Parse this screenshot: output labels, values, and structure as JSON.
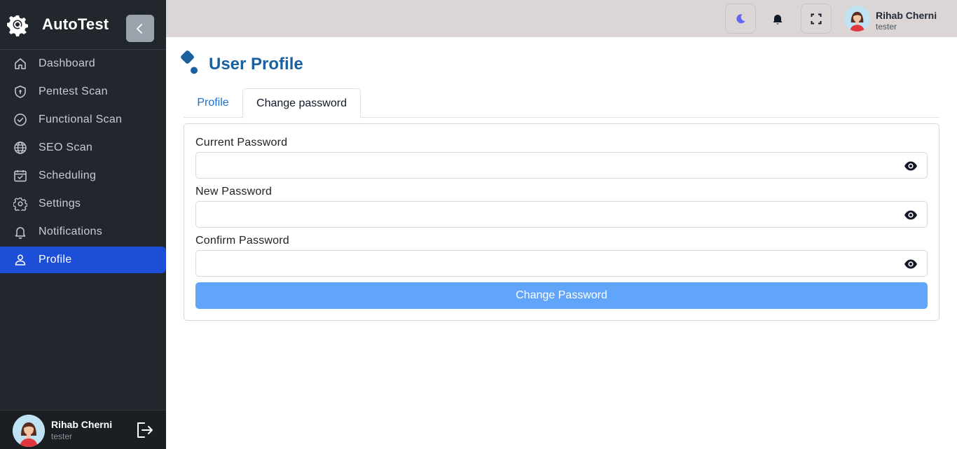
{
  "app": {
    "name": "AutoTest",
    "collapse_icon": "chevron-left-icon"
  },
  "sidebar": {
    "items": [
      {
        "label": "Dashboard",
        "icon": "home-icon",
        "active": false
      },
      {
        "label": "Pentest Scan",
        "icon": "shield-icon",
        "active": false
      },
      {
        "label": "Functional Scan",
        "icon": "check-circle-icon",
        "active": false
      },
      {
        "label": "SEO Scan",
        "icon": "globe-icon",
        "active": false
      },
      {
        "label": "Scheduling",
        "icon": "calendar-check-icon",
        "active": false
      },
      {
        "label": "Settings",
        "icon": "gear-icon",
        "active": false
      },
      {
        "label": "Notifications",
        "icon": "bell-icon",
        "active": false
      },
      {
        "label": "Profile",
        "icon": "user-icon",
        "active": true
      }
    ],
    "user": {
      "name": "Rihab Cherni",
      "role": "tester"
    }
  },
  "topbar": {
    "user": {
      "name": "Rihab Cherni",
      "role": "tester"
    },
    "buttons": [
      "moon-icon",
      "bell-icon",
      "fullscreen-icon"
    ]
  },
  "page": {
    "title": "User Profile",
    "tabs": [
      {
        "label": "Profile",
        "active": false
      },
      {
        "label": "Change password",
        "active": true
      }
    ],
    "form": {
      "current_password": {
        "label": "Current Password",
        "value": ""
      },
      "new_password": {
        "label": "New Password",
        "value": ""
      },
      "confirm_password": {
        "label": "Confirm Password",
        "value": ""
      },
      "submit_label": "Change Password"
    }
  },
  "colors": {
    "sidebar_bg": "#22262d",
    "active_item": "#1d4ed8",
    "topbar_bg": "#dbd5d5",
    "title": "#1a5f9e",
    "submit_button": "#60a5fa",
    "tab_link": "#1d6fd1"
  }
}
